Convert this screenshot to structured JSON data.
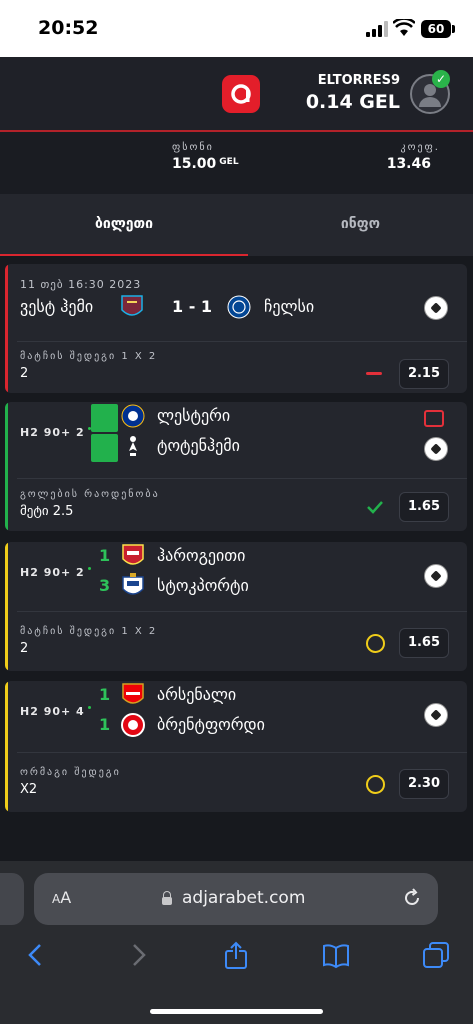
{
  "status_bar": {
    "time": "20:52",
    "battery": "60"
  },
  "header": {
    "username": "ELTORRES9",
    "balance": "0.14 GEL"
  },
  "summary": {
    "stake_label": "ფსონი",
    "stake_value": "15.00",
    "stake_currency": "GEL",
    "odds_label": "კოეფ.",
    "odds_value": "13.46"
  },
  "tabs": [
    {
      "label": "ბილეთი"
    },
    {
      "label": "ინფო"
    }
  ],
  "bets": [
    {
      "accent": "#d9262f",
      "date": "11 თებ 16:30 2023",
      "home": "ვესტ ჰემი",
      "away": "ჩელსი",
      "score": "1 - 1",
      "market": "მატჩის შედეგი 1 X 2",
      "selection": "2",
      "odd": "2.15",
      "status": "lost"
    },
    {
      "accent": "#22b14c",
      "time": "H2 90+ 2",
      "home": "ლესტერი",
      "away": "ტოტენჰემი",
      "home_score": "",
      "away_score": "",
      "market": "გოლების რაოდენობა",
      "selection": "მეტი 2.5",
      "odd": "1.65",
      "status": "won"
    },
    {
      "accent": "#f0cd1a",
      "time": "H2 90+ 2",
      "home": "ჰაროგეითი",
      "away": "სტოკპორტი",
      "home_score": "1",
      "away_score": "3",
      "market": "მატჩის შედეგი 1 X 2",
      "selection": "2",
      "odd": "1.65",
      "status": "pending"
    },
    {
      "accent": "#f0cd1a",
      "time": "H2 90+ 4",
      "home": "არსენალი",
      "away": "ბრენტფორდი",
      "home_score": "1",
      "away_score": "1",
      "market": "ორმაგი შედეგი",
      "selection": "X2",
      "odd": "2.30",
      "status": "pending"
    }
  ],
  "browser": {
    "aa": "AA",
    "url": "adjarabet.com"
  },
  "colors": {
    "brand": "#e31e2a",
    "win": "#22b14c",
    "pending": "#f0cd1a",
    "loss": "#e3303a"
  }
}
